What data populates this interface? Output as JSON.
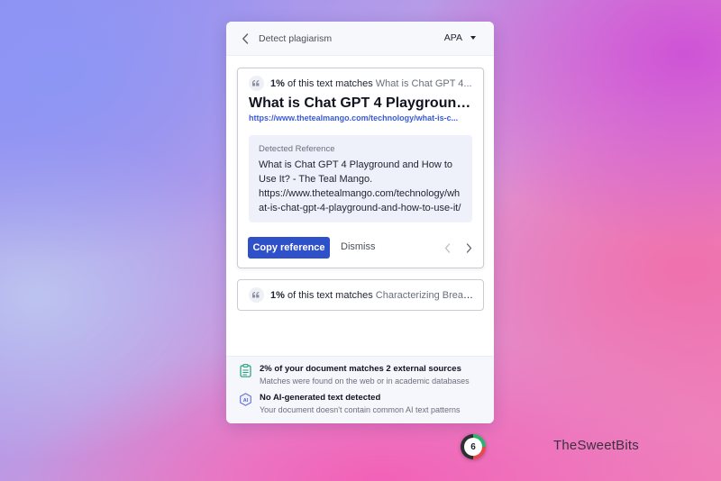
{
  "header": {
    "title": "Detect plagiarism",
    "citation_style": "APA"
  },
  "matches": [
    {
      "percent": "1%",
      "text": "of this text matches",
      "source_short": "What is Chat GPT 4...",
      "title": "What is Chat GPT 4 Playground...",
      "url": "https://www.thetealmango.com/technology/what-is-c...",
      "reference_label": "Detected Reference",
      "reference_text": "What is Chat GPT 4 Playground and How to Use It? - The Teal Mango. https://www.thetealmango.com/technology/what-is-chat-gpt-4-playground-and-how-to-use-it/",
      "copy_label": "Copy reference",
      "dismiss_label": "Dismiss"
    },
    {
      "percent": "1%",
      "text": "of this text matches",
      "source_short": "Characterizing Break..."
    }
  ],
  "summary": {
    "sources_title": "2% of your document matches 2 external sources",
    "sources_sub": "Matches were found on the web or in academic databases",
    "ai_title": "No AI-generated text detected",
    "ai_sub": "Your document doesn't contain common AI text patterns",
    "ai_icon_text": "AI"
  },
  "badge": {
    "count": "6"
  },
  "watermark": "TheSweetBits",
  "icons": {
    "back": "chevron-left-icon",
    "quote": "quote-icon",
    "prev": "chevron-left-icon",
    "next": "chevron-right-icon",
    "sources": "clipboard-icon",
    "ai": "ai-detector-icon"
  },
  "colors": {
    "accent": "#2e50c9",
    "link": "#3b5bd6",
    "reference_bg": "#eef1fa"
  }
}
